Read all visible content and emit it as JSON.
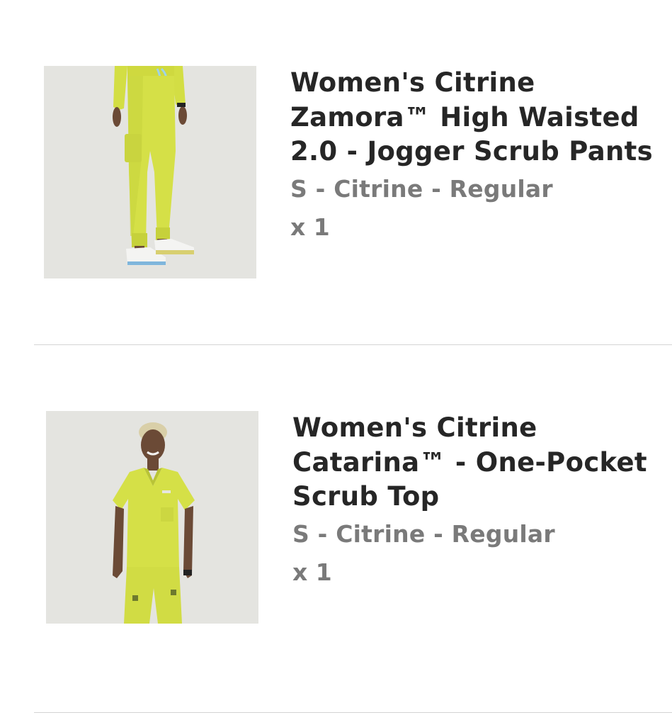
{
  "cart": {
    "items": [
      {
        "title": "Women's Citrine Zamora™ High Waisted 2.0 - Jogger Scrub Pants",
        "variant": "S - Citrine - Regular",
        "quantity": "x 1",
        "image_icon": "product-photo-jogger-pants"
      },
      {
        "title": "Women's Citrine Catarina™ - One-Pocket Scrub Top",
        "variant": "S - Citrine - Regular",
        "quantity": "x 1",
        "image_icon": "product-photo-scrub-top"
      }
    ]
  },
  "colors": {
    "product_color": "#d5e047",
    "image_background": "#e4e4e0",
    "title_text": "#262626",
    "secondary_text": "#7a7a7a",
    "divider": "#d4d4d4"
  }
}
